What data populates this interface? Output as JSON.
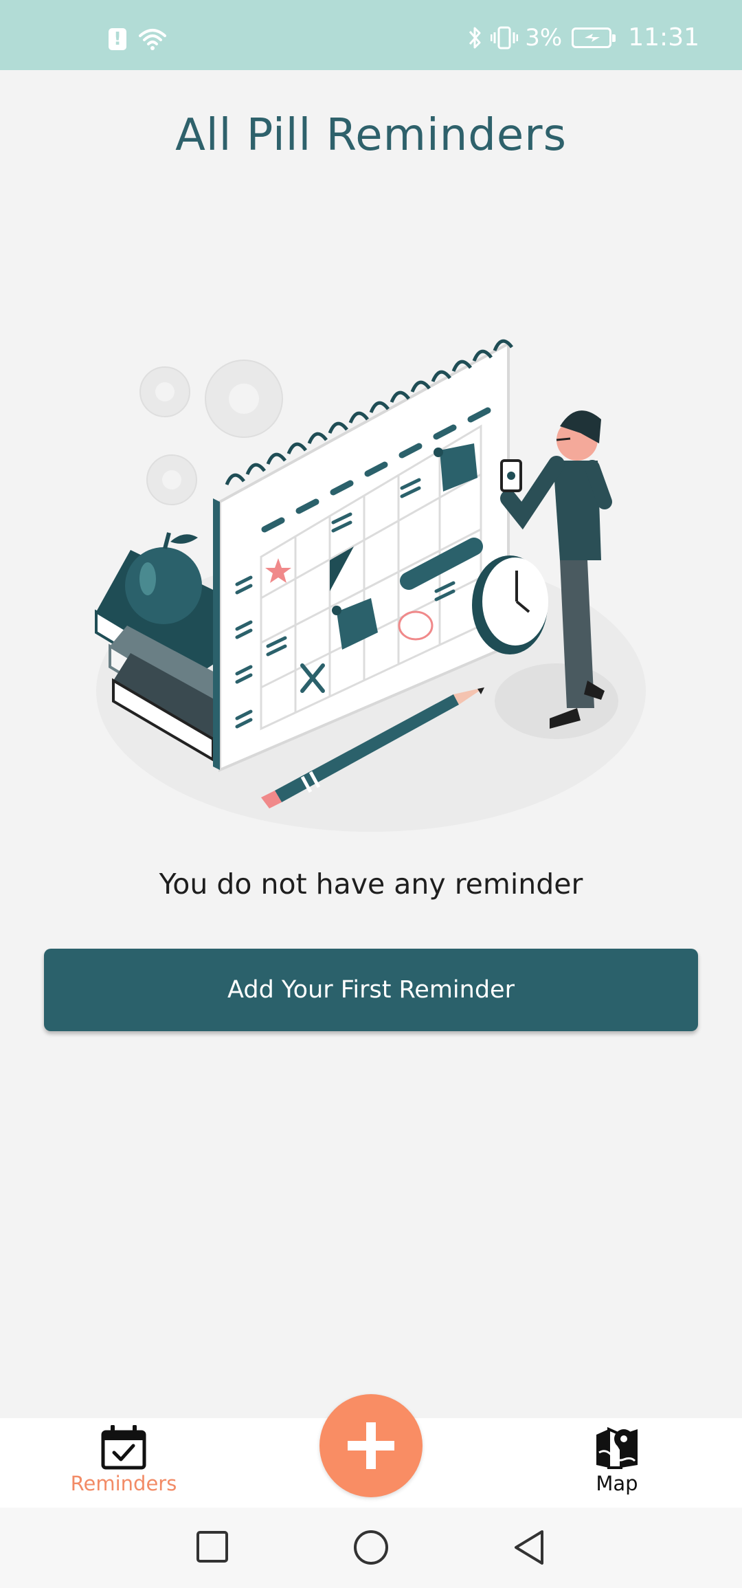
{
  "status_bar": {
    "alert_glyph": "!",
    "battery_percent": "3%",
    "time": "11:31",
    "icons": [
      "alert-icon",
      "wifi-icon",
      "bluetooth-icon",
      "vibrate-icon",
      "battery-charging-icon"
    ]
  },
  "page": {
    "title": "All Pill Reminders",
    "empty_message": "You do not have any reminder",
    "add_first_button": "Add Your First Reminder"
  },
  "bottom_nav": {
    "items": [
      {
        "label": "Reminders",
        "icon": "calendar-check-icon",
        "active": true
      },
      {
        "label": "Map",
        "icon": "map-pin-icon",
        "active": false
      }
    ],
    "fab_icon": "plus-icon"
  },
  "system_nav": {
    "icons": [
      "recent-apps-icon",
      "home-icon",
      "back-icon"
    ]
  },
  "colors": {
    "status_bar": "#b2dcd6",
    "title": "#2e616b",
    "primary": "#2b616b",
    "accent": "#f98d64",
    "active_nav_label": "#f28b66",
    "background": "#f3f3f3"
  }
}
